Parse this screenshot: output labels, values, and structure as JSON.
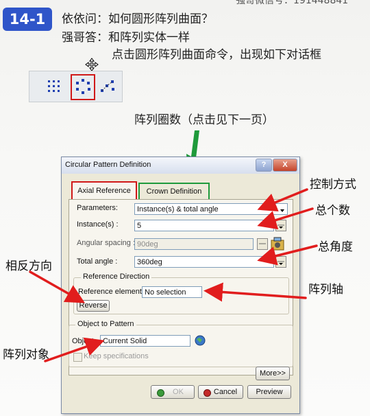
{
  "top_right": "强哥微信号：191448841",
  "badge": "14-1",
  "question": "依依问：如何圆形阵列曲面？",
  "answer1": "强哥答：和阵列实体一样",
  "answer2": "点击圆形阵列曲面命令，出现如下对话框",
  "caption": "阵列圈数（点击见下一页）",
  "annotations": {
    "control_mode": "控制方式",
    "total_count": "总个数",
    "total_angle": "总角度",
    "reverse_dir": "相反方向",
    "pattern_axis": "阵列轴",
    "pattern_object": "阵列对象"
  },
  "dialog": {
    "title": "Circular Pattern Definition",
    "help": "?",
    "close": "X",
    "tabs": [
      "Axial Reference",
      "Crown Definition"
    ],
    "parameters_label": "Parameters:",
    "parameters_value": "Instance(s) & total angle",
    "instances_label": "Instance(s) :",
    "instances_value": "5",
    "angular_label": "Angular spacing :",
    "angular_value": "90deg",
    "total_angle_label": "Total angle :",
    "total_angle_value": "360deg",
    "ref_dir_title": "Reference Direction",
    "ref_element_label": "Reference element:",
    "ref_element_value": "No selection",
    "reverse": "Reverse",
    "object_title": "Object to Pattern",
    "object_label": "Object:",
    "object_value": "Current Solid",
    "keep_spec": "Keep specifications",
    "more": "More>>",
    "ok": "OK",
    "cancel": "Cancel",
    "preview": "Preview"
  },
  "colors": {
    "badge": "#2f55c9",
    "red": "#d01818",
    "green": "#1e9a3b",
    "arrow": "#e11d1d"
  }
}
